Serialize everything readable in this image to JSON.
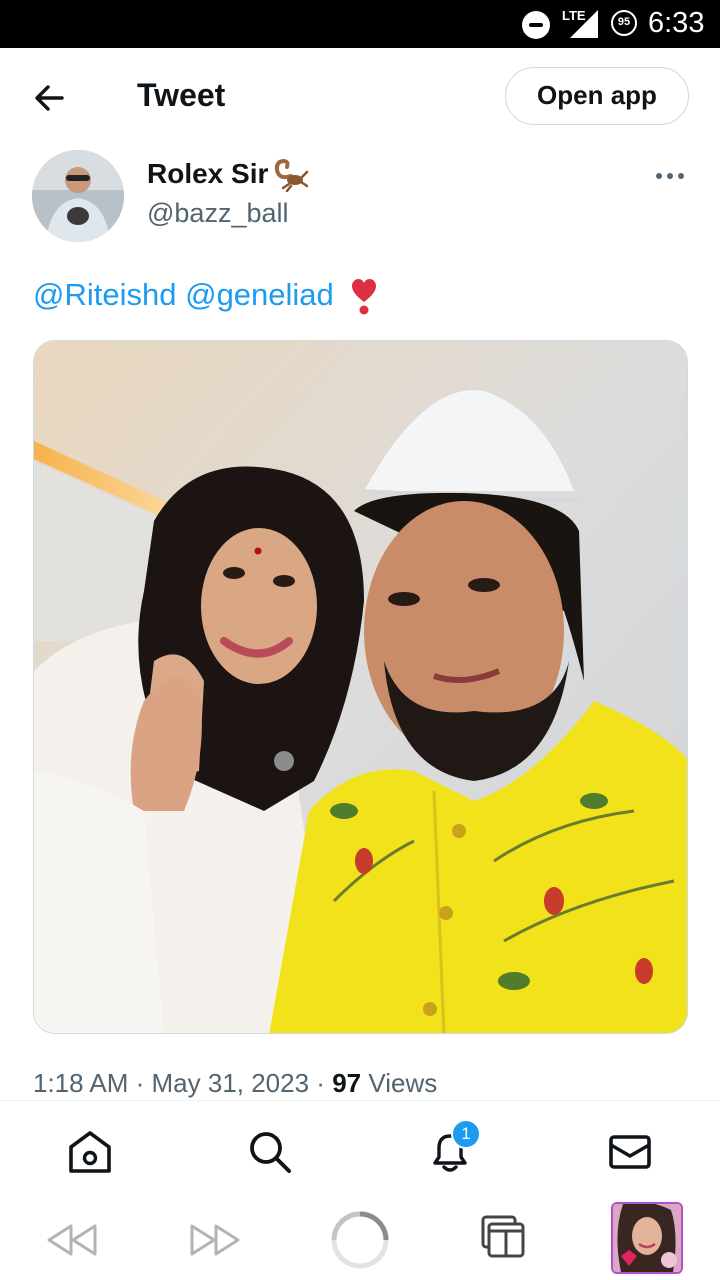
{
  "status_bar": {
    "network": "LTE",
    "battery": "95",
    "time": "6:33"
  },
  "header": {
    "title": "Tweet",
    "open_app_label": "Open app"
  },
  "tweet": {
    "author_name": "Rolex Sir",
    "author_handle": "@bazz_ball",
    "mentions": [
      "@Riteishd",
      "@geneliad"
    ],
    "time": "1:18 AM",
    "date": "May 31, 2023",
    "views_count": "97",
    "views_label": "Views"
  },
  "nav": {
    "notifications_badge": "1"
  },
  "colors": {
    "accent": "#1d9bf0",
    "text": "#0f1419",
    "secondary": "#536471",
    "heart": "#e0245e",
    "kurta": "#f2e21c"
  }
}
